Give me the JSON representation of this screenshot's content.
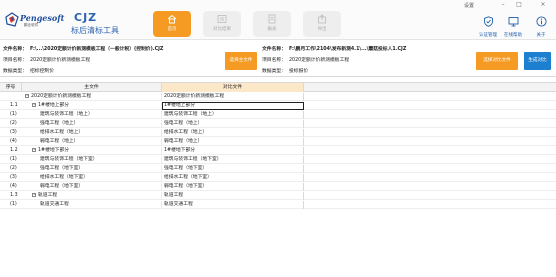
{
  "app": {
    "brand": "Pengesoft",
    "brand_sub": "鹏业软件",
    "title": "CJZ",
    "subtitle": "标后清标工具"
  },
  "toolbar": {
    "home_label": "首页",
    "compare_label": "对比结果",
    "report_label": "报表",
    "export_label": "导出"
  },
  "window": {
    "settings_label": "设置",
    "auth_label": "认证管理",
    "help_label": "在线帮助",
    "about_label": "关于"
  },
  "main_file": {
    "file_label": "文件名称：",
    "file_value": "F:\\...\\2020定额计价新测模板工程（一般计税）(控制价).CJZ",
    "project_label": "项目名称：",
    "project_value": "2020定额计价新测模板工程",
    "type_label": "数据类型：",
    "type_value": "招标控制价",
    "select_button": "选择主文件"
  },
  "compare_file": {
    "file_label": "文件名称：",
    "file_value": "F:\\鹏月工作\\2104\\发布新测4.1\\...\\蘑菇投标人1.CJZ",
    "project_label": "项目名称：",
    "project_value": "2020定额计价新测模板工程",
    "type_label": "数据类型：",
    "type_value": "投标报价",
    "select_button": "选择对比文件",
    "generate_button": "生成对比"
  },
  "grid": {
    "headers": {
      "seq": "序号",
      "main": "主文件",
      "compare": "对比文件"
    },
    "rows": [
      {
        "seq": "",
        "level": 0,
        "toggle": "−",
        "main": "2020定额计价新测模板工程",
        "compare": "2020定额计价新测模板工程"
      },
      {
        "seq": "1.1",
        "level": 1,
        "toggle": "−",
        "main": "1#楼地上部分",
        "compare": "1#楼地上部分",
        "selected": true
      },
      {
        "seq": "(1)",
        "level": 2,
        "toggle": "",
        "main": "建筑与装饰工程（地上）",
        "compare": "建筑与装饰工程（地上）"
      },
      {
        "seq": "(2)",
        "level": 2,
        "toggle": "",
        "main": "强电工程（地上）",
        "compare": "强电工程（地上）"
      },
      {
        "seq": "(3)",
        "level": 2,
        "toggle": "",
        "main": "给排水工程（地上）",
        "compare": "给排水工程（地上）"
      },
      {
        "seq": "(4)",
        "level": 2,
        "toggle": "",
        "main": "弱电工程（地上）",
        "compare": "弱电工程（地上）"
      },
      {
        "seq": "1.2",
        "level": 1,
        "toggle": "−",
        "main": "1#楼地下部分",
        "compare": "1#楼地下部分"
      },
      {
        "seq": "(1)",
        "level": 2,
        "toggle": "",
        "main": "建筑与装饰工程（地下室）",
        "compare": "建筑与装饰工程（地下室）"
      },
      {
        "seq": "(2)",
        "level": 2,
        "toggle": "",
        "main": "强电工程（地下室）",
        "compare": "强电工程（地下室）"
      },
      {
        "seq": "(3)",
        "level": 2,
        "toggle": "",
        "main": "给排水工程（地下室）",
        "compare": "给排水工程（地下室）"
      },
      {
        "seq": "(4)",
        "level": 2,
        "toggle": "",
        "main": "弱电工程（地下室）",
        "compare": "弱电工程（地下室）"
      },
      {
        "seq": "1.3",
        "level": 1,
        "toggle": "−",
        "main": "轨道工程",
        "compare": "轨道工程"
      },
      {
        "seq": "(1)",
        "level": 2,
        "toggle": "",
        "main": "轨道交通工程",
        "compare": "轨道交通工程"
      }
    ]
  },
  "colors": {
    "accent_orange": "#f59a23",
    "accent_blue": "#1d7fcf",
    "title_blue": "#2c63b0",
    "compare_header": "#fde7c9"
  }
}
